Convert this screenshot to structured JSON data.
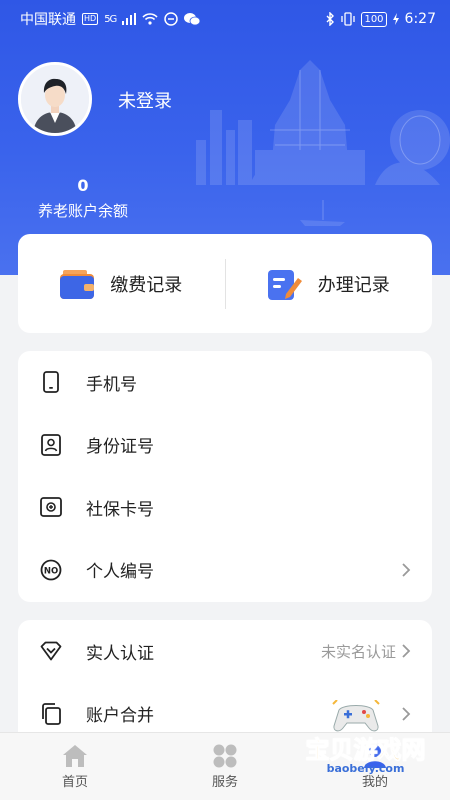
{
  "status_bar": {
    "carrier": "中国联通",
    "hd": "HD",
    "network": "5G",
    "battery": "100",
    "time": "6:27"
  },
  "profile": {
    "login_status": "未登录",
    "balance_value": "0",
    "balance_label": "养老账户余额"
  },
  "records": [
    {
      "label": "缴费记录",
      "icon": "wallet-icon"
    },
    {
      "label": "办理记录",
      "icon": "edit-document-icon"
    }
  ],
  "info_list": [
    {
      "label": "手机号",
      "icon": "phone-icon"
    },
    {
      "label": "身份证号",
      "icon": "id-card-icon"
    },
    {
      "label": "社保卡号",
      "icon": "social-security-card-icon"
    },
    {
      "label": "个人编号",
      "icon": "no-badge-icon"
    }
  ],
  "account_list": [
    {
      "label": "实人认证",
      "value": "未实名认证",
      "icon": "diamond-check-icon"
    },
    {
      "label": "账户合并",
      "value": "",
      "icon": "copy-icon"
    }
  ],
  "nav": [
    {
      "label": "首页",
      "icon": "home-icon"
    },
    {
      "label": "服务",
      "icon": "grid-icon"
    },
    {
      "label": "我的",
      "icon": "user-icon"
    }
  ],
  "watermark": {
    "text": "宝贝游戏网",
    "domain": "baobeiy.com"
  },
  "colors": {
    "brand_blue": "#3a63ec",
    "wallet_orange": "#f08c3a",
    "doc_blue": "#4a72f0",
    "muted_text": "#9a9a9a"
  }
}
